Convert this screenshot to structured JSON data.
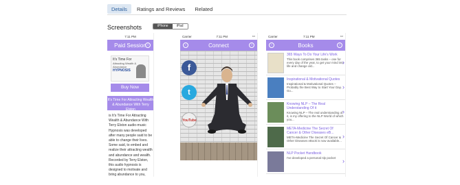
{
  "tabs": [
    "Details",
    "Ratings and Reviews",
    "Related"
  ],
  "screenshots": {
    "title": "Screenshots",
    "devices": [
      "iPhone",
      "iPad"
    ],
    "phone1": {
      "status_time": "7:11 PM",
      "nav_title": "Paid Session",
      "book_title": "It's Time For",
      "book_sub": "Attracting Wealth & Abundance",
      "book_brand": "HYPNOSIS",
      "buy_label": "Buy Now",
      "banner": "It's Time For Attracting Wealth & Abundance With Terry Elston",
      "body": "is It's Time For Attracting Wealth & Abundance With Terry Elston audio-music Hypnosis was developed after many people said to be able to change their lives. Some said, to embed and realize their attracting wealth and abundance and wealth. Recorded by Terry Elston, this audio hypnosis is designed to motivate and bring abundance to you, even in your sleep! If you like the words wealth and abundance"
    },
    "phone2": {
      "status_carrier": "Carrier",
      "status_time": "7:11 PM",
      "nav_title": "Connect",
      "social": [
        "f",
        "t",
        "YouTube"
      ]
    },
    "phone3": {
      "status_carrier": "Carrier",
      "status_time": "7:11 PM",
      "nav_title": "Books",
      "books": [
        {
          "title": "365 Ways To Do Your Life's Work",
          "desc": "This book comprises 365 tasks – one for every day of the year, to get your mind into life and change old..."
        },
        {
          "title": "Inspirational & Motivational Quotes",
          "desc": "Inspirational & Motivational Quotes – Probably the Best Way to Start Your Day. Go..."
        },
        {
          "title": "Knowing NLP – The Real Understanding Of it",
          "desc": "Knowing NLP – The real understanding of it, is my offering to the NLP World of which you..."
        },
        {
          "title": "META-Medicine The Secret Of Cancer & Other Diseases eB...",
          "desc": "META-Medicine The Secret Of Cancer & Other Diseases eBook is now available..."
        },
        {
          "title": "NLP Pocket Handbook",
          "desc": "I've developed a personal nlp pocket"
        }
      ]
    }
  }
}
